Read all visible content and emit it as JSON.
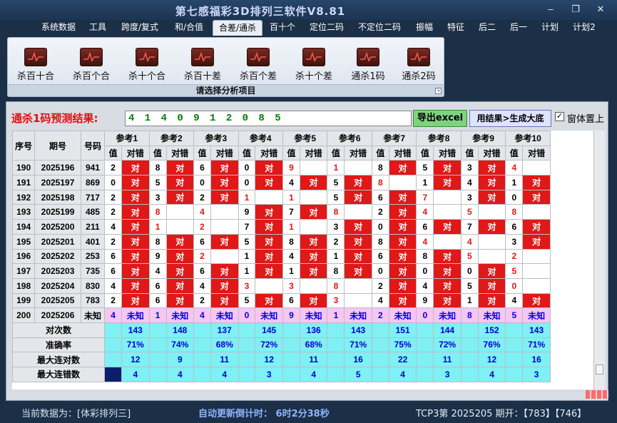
{
  "window": {
    "title": "第七感福彩3D排列三软件V8.81",
    "min_symbol": "–",
    "max_symbol": "❐",
    "close_symbol": "✕"
  },
  "menu": [
    "系统数据",
    "工具",
    "跨度/复式",
    "和/合值",
    "合差/通杀",
    "百十个",
    "定位二码",
    "不定位二码",
    "振幅",
    "特征",
    "后二",
    "后一",
    "计划",
    "计划2"
  ],
  "menu_active_index": 4,
  "ribbon": {
    "items": [
      "杀百十合",
      "杀百个合",
      "杀十个合",
      "杀百十差",
      "杀百个差",
      "杀十个差",
      "通杀1码",
      "通杀2码"
    ],
    "footer": "请选择分析项目",
    "corner": "↘"
  },
  "prediction": {
    "label": "通杀1码预测结果:",
    "value": "4 1 4 0 9 1 2 0 8 5",
    "export_button": "导出excel",
    "generate_button": "用结果>生成大底",
    "checkbox_label": "窗体置上",
    "checkbox_checked": true,
    "check_mark": "✓"
  },
  "table": {
    "headers": {
      "seq": "序号",
      "period": "期号",
      "number": "号码"
    },
    "ref_headers": [
      "参考1",
      "参考2",
      "参考3",
      "参考4",
      "参考5",
      "参考6",
      "参考7",
      "参考8",
      "参考9",
      "参考10"
    ],
    "sub_value": "值",
    "sub_result": "对错",
    "rows": [
      {
        "seq": "190",
        "period": "2025196",
        "number": "941",
        "cells": [
          [
            "2",
            "对"
          ],
          [
            "8",
            "对"
          ],
          [
            "6",
            "对"
          ],
          [
            "0",
            "对"
          ],
          [
            "9",
            ""
          ],
          [
            "1",
            ""
          ],
          [
            "8",
            "对"
          ],
          [
            "5",
            "对"
          ],
          [
            "3",
            "对"
          ],
          [
            "4",
            ""
          ]
        ]
      },
      {
        "seq": "191",
        "period": "2025197",
        "number": "869",
        "cells": [
          [
            "0",
            "对"
          ],
          [
            "5",
            "对"
          ],
          [
            "0",
            "对"
          ],
          [
            "0",
            "对"
          ],
          [
            "4",
            "对"
          ],
          [
            "5",
            "对"
          ],
          [
            "8",
            ""
          ],
          [
            "1",
            "对"
          ],
          [
            "4",
            "对"
          ],
          [
            "1",
            "对"
          ]
        ]
      },
      {
        "seq": "192",
        "period": "2025198",
        "number": "717",
        "cells": [
          [
            "2",
            "对"
          ],
          [
            "3",
            "对"
          ],
          [
            "2",
            "对"
          ],
          [
            "1",
            ""
          ],
          [
            "1",
            ""
          ],
          [
            "5",
            "对"
          ],
          [
            "6",
            "对"
          ],
          [
            "7",
            ""
          ],
          [
            "3",
            "对"
          ],
          [
            "0",
            "对"
          ]
        ]
      },
      {
        "seq": "193",
        "period": "2025199",
        "number": "485",
        "cells": [
          [
            "2",
            "对"
          ],
          [
            "8",
            ""
          ],
          [
            "4",
            ""
          ],
          [
            "9",
            "对"
          ],
          [
            "7",
            "对"
          ],
          [
            "8",
            ""
          ],
          [
            "2",
            "对"
          ],
          [
            "4",
            ""
          ],
          [
            "5",
            ""
          ],
          [
            "8",
            ""
          ]
        ]
      },
      {
        "seq": "194",
        "period": "2025200",
        "number": "211",
        "cells": [
          [
            "4",
            "对"
          ],
          [
            "1",
            ""
          ],
          [
            "2",
            ""
          ],
          [
            "7",
            "对"
          ],
          [
            "1",
            ""
          ],
          [
            "3",
            "对"
          ],
          [
            "0",
            "对"
          ],
          [
            "6",
            "对"
          ],
          [
            "7",
            "对"
          ],
          [
            "6",
            "对"
          ]
        ]
      },
      {
        "seq": "195",
        "period": "2025201",
        "number": "401",
        "cells": [
          [
            "2",
            "对"
          ],
          [
            "8",
            "对"
          ],
          [
            "6",
            "对"
          ],
          [
            "5",
            "对"
          ],
          [
            "8",
            "对"
          ],
          [
            "2",
            "对"
          ],
          [
            "8",
            "对"
          ],
          [
            "4",
            ""
          ],
          [
            "4",
            ""
          ],
          [
            "3",
            "对"
          ]
        ]
      },
      {
        "seq": "196",
        "period": "2025202",
        "number": "253",
        "cells": [
          [
            "6",
            "对"
          ],
          [
            "9",
            "对"
          ],
          [
            "2",
            ""
          ],
          [
            "1",
            "对"
          ],
          [
            "4",
            "对"
          ],
          [
            "1",
            "对"
          ],
          [
            "6",
            "对"
          ],
          [
            "8",
            "对"
          ],
          [
            "5",
            ""
          ],
          [
            "2",
            ""
          ]
        ]
      },
      {
        "seq": "197",
        "period": "2025203",
        "number": "735",
        "cells": [
          [
            "6",
            "对"
          ],
          [
            "4",
            "对"
          ],
          [
            "6",
            "对"
          ],
          [
            "1",
            "对"
          ],
          [
            "1",
            "对"
          ],
          [
            "8",
            "对"
          ],
          [
            "0",
            "对"
          ],
          [
            "0",
            "对"
          ],
          [
            "0",
            "对"
          ],
          [
            "5",
            ""
          ]
        ]
      },
      {
        "seq": "198",
        "period": "2025204",
        "number": "830",
        "cells": [
          [
            "4",
            "对"
          ],
          [
            "6",
            "对"
          ],
          [
            "4",
            "对"
          ],
          [
            "3",
            ""
          ],
          [
            "3",
            ""
          ],
          [
            "8",
            ""
          ],
          [
            "2",
            "对"
          ],
          [
            "4",
            "对"
          ],
          [
            "5",
            "对"
          ],
          [
            "0",
            ""
          ]
        ]
      },
      {
        "seq": "199",
        "period": "2025205",
        "number": "783",
        "cells": [
          [
            "2",
            "对"
          ],
          [
            "6",
            "对"
          ],
          [
            "2",
            "对"
          ],
          [
            "5",
            "对"
          ],
          [
            "6",
            "对"
          ],
          [
            "3",
            ""
          ],
          [
            "4",
            "对"
          ],
          [
            "9",
            "对"
          ],
          [
            "1",
            "对"
          ],
          [
            "4",
            "对"
          ]
        ]
      }
    ],
    "pending_row": {
      "seq": "200",
      "period": "2025206",
      "number": "未知",
      "values": [
        "4",
        "1",
        "4",
        "0",
        "9",
        "1",
        "2",
        "0",
        "8",
        "5"
      ],
      "result": "未知"
    },
    "stats": [
      {
        "label": "对次数",
        "values": [
          "143",
          "148",
          "137",
          "145",
          "136",
          "143",
          "151",
          "144",
          "152",
          "143"
        ]
      },
      {
        "label": "准确率",
        "values": [
          "71%",
          "74%",
          "68%",
          "72%",
          "68%",
          "71%",
          "75%",
          "72%",
          "76%",
          "71%"
        ]
      },
      {
        "label": "最大连对数",
        "values": [
          "12",
          "9",
          "11",
          "12",
          "11",
          "16",
          "22",
          "11",
          "12",
          "16"
        ]
      },
      {
        "label": "最大连错数",
        "values": [
          "4",
          "4",
          "4",
          "3",
          "4",
          "5",
          "4",
          "3",
          "4",
          "3"
        ]
      }
    ]
  },
  "status": {
    "current_data": "当前数据为：[体彩排列三]",
    "countdown": "自动更新倒计时：  6时2分38秒",
    "draw_info": "TCP3第 2025205 期开：【783】【746】"
  },
  "colors": {
    "red": "#e01818",
    "cyan": "#7ff0f4",
    "pink": "#f7c6f3",
    "blue_text": "#0000cc",
    "green_text": "#008000"
  }
}
